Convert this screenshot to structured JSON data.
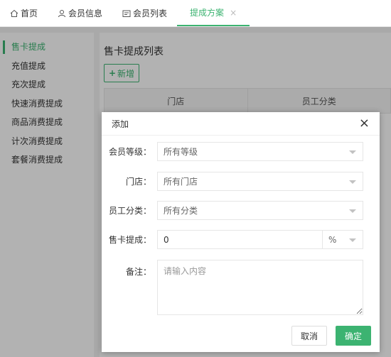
{
  "tabs": [
    {
      "label": "首页",
      "icon": "home-icon"
    },
    {
      "label": "会员信息",
      "icon": "user-icon"
    },
    {
      "label": "会员列表",
      "icon": "id-card-icon"
    },
    {
      "label": "提成方案",
      "close": "×"
    }
  ],
  "sidebar": {
    "items": [
      {
        "label": "售卡提成"
      },
      {
        "label": "充值提成"
      },
      {
        "label": "充次提成"
      },
      {
        "label": "快速消费提成"
      },
      {
        "label": "商品消费提成"
      },
      {
        "label": "计次消费提成"
      },
      {
        "label": "套餐消费提成"
      }
    ]
  },
  "main": {
    "title": "售卡提成列表",
    "add_button": {
      "plus": "+",
      "label": "新增"
    },
    "table_headers": [
      "门店",
      "员工分类"
    ]
  },
  "modal": {
    "title": "添加",
    "close": "×",
    "fields": {
      "member_level": {
        "label": "会员等级：",
        "value": "所有等级"
      },
      "store": {
        "label": "门店：",
        "value": "所有门店"
      },
      "staff_category": {
        "label": "员工分类：",
        "value": "所有分类"
      },
      "card_commission": {
        "label": "售卡提成：",
        "value": "0",
        "unit": "%"
      },
      "remark": {
        "label": "备注：",
        "placeholder": "请输入内容"
      }
    },
    "cancel_label": "取消",
    "ok_label": "确定"
  },
  "colors": {
    "accent": "#3cb371"
  }
}
